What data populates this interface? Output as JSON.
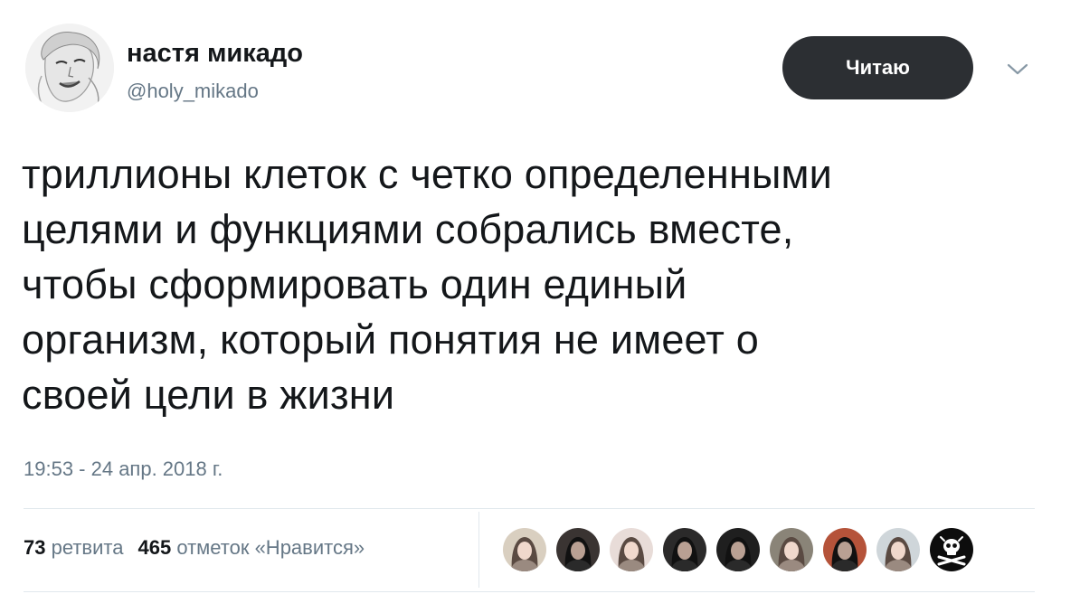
{
  "author": {
    "display_name": "настя микадо",
    "handle": "@holy_mikado",
    "avatar_icon": "user-avatar"
  },
  "follow_button": {
    "label": "Читаю"
  },
  "menu": {
    "icon": "chevron-down-icon"
  },
  "tweet": {
    "lines": [
      "триллионы клеток с четко определенными",
      "целями и функциями собрались вместе,",
      "чтобы сформировать один единый",
      "организм, который понятия не имеет о",
      "своей цели в жизни"
    ],
    "timestamp": "19:53 - 24 апр. 2018 г."
  },
  "stats": {
    "retweets_count": "73",
    "retweets_label": "ретвита",
    "likes_count": "465",
    "likes_label": "отметок «Нравится»"
  },
  "likers": [
    {
      "icon": "user-avatar",
      "bg": "#d9cfc0"
    },
    {
      "icon": "user-avatar",
      "bg": "#3a3432"
    },
    {
      "icon": "user-avatar",
      "bg": "#e8dcd8"
    },
    {
      "icon": "user-avatar",
      "bg": "#2b2a2a"
    },
    {
      "icon": "user-avatar",
      "bg": "#1f1f1f"
    },
    {
      "icon": "user-avatar",
      "bg": "#8a8478"
    },
    {
      "icon": "user-avatar",
      "bg": "#b5533a"
    },
    {
      "icon": "user-avatar",
      "bg": "#cfd6da"
    },
    {
      "icon": "skull-icon",
      "bg": "#0d0d0d"
    }
  ]
}
